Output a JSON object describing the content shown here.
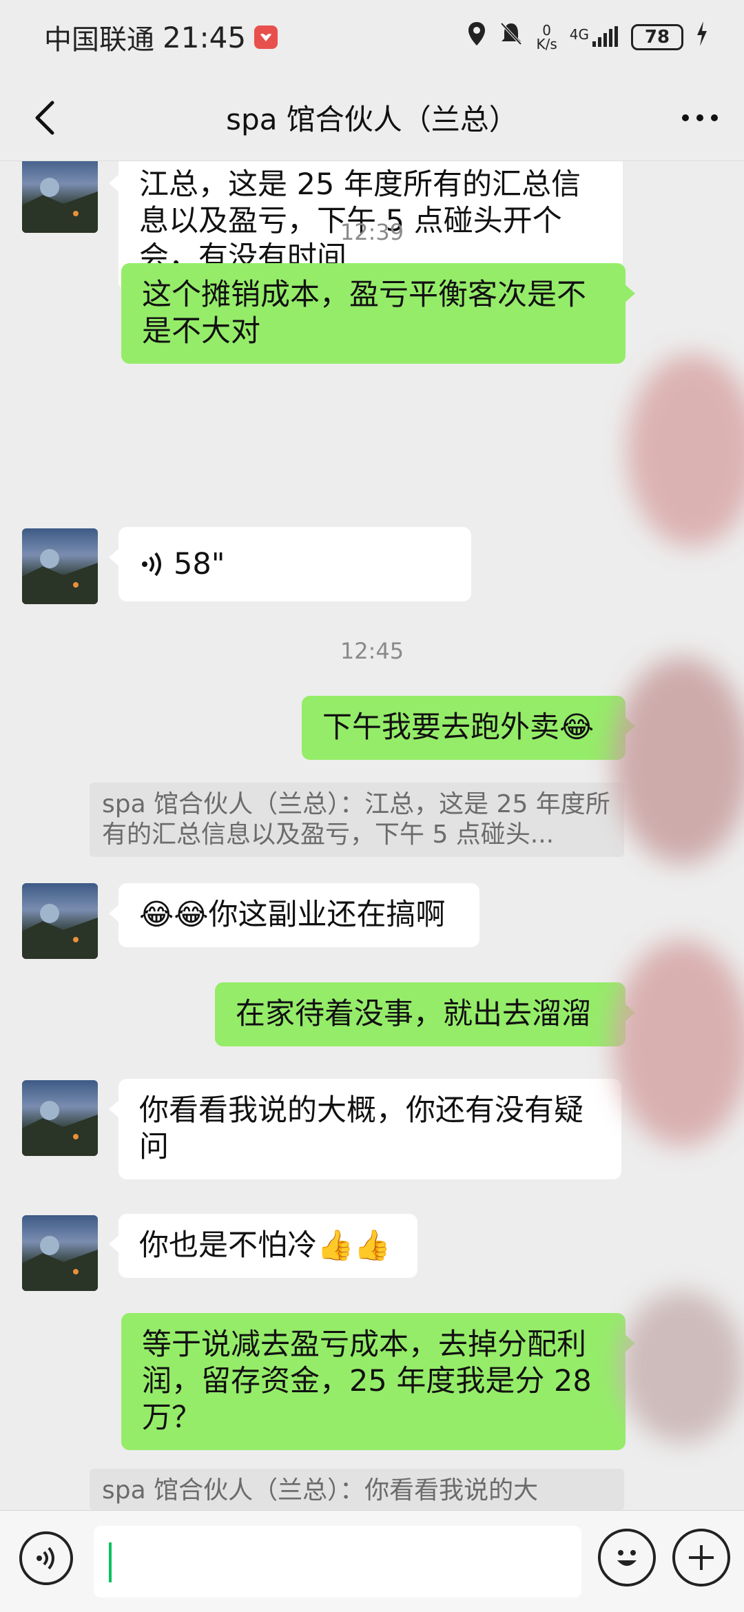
{
  "status_bar": {
    "carrier": "中国联通",
    "time": "21:45",
    "net_speed_value": "0",
    "net_speed_unit": "K/s",
    "network": "4G",
    "battery": "78"
  },
  "header": {
    "title": "spa 馆合伙人（兰总）"
  },
  "messages": [
    {
      "side": "left",
      "type": "text",
      "text": "江总，这是 25 年度所有的汇总信息以及盈亏，下午 5 点碰头开个会，有没有时间"
    },
    {
      "type": "time",
      "text": "12:39"
    },
    {
      "side": "right",
      "type": "text",
      "text": "这个摊销成本，盈亏平衡客次是不是不大对"
    },
    {
      "side": "left",
      "type": "voice",
      "text": "58\""
    },
    {
      "type": "time",
      "text": "12:45"
    },
    {
      "side": "right",
      "type": "text",
      "text": "下午我要去跑外卖😂"
    },
    {
      "type": "quote",
      "text": "spa 馆合伙人（兰总）：江总，这是 25 年度所有的汇总信息以及盈亏，下午 5 点碰头..."
    },
    {
      "side": "left",
      "type": "text",
      "text": "😂😂你这副业还在搞啊"
    },
    {
      "side": "right",
      "type": "text",
      "text": "在家待着没事，就出去溜溜"
    },
    {
      "side": "left",
      "type": "text",
      "text": "你看看我说的大概，你还有没有疑问"
    },
    {
      "side": "left",
      "type": "text",
      "text": "你也是不怕冷👍👍"
    },
    {
      "side": "right",
      "type": "text",
      "text": "等于说减去盈亏成本，去掉分配利润，留存资金，25 年度我是分 28 万？"
    },
    {
      "type": "quote",
      "text": "spa 馆合伙人（兰总）：你看看我说的大"
    }
  ],
  "colors": {
    "background": "#ededed",
    "bubble_self": "#95ec69",
    "bubble_other": "#ffffff",
    "caret": "#07c160"
  },
  "icons": {
    "back": "back-chevron-icon",
    "more": "more-dots-icon",
    "voice": "voice-input-icon",
    "emoji": "emoji-icon",
    "plus": "plus-icon"
  }
}
